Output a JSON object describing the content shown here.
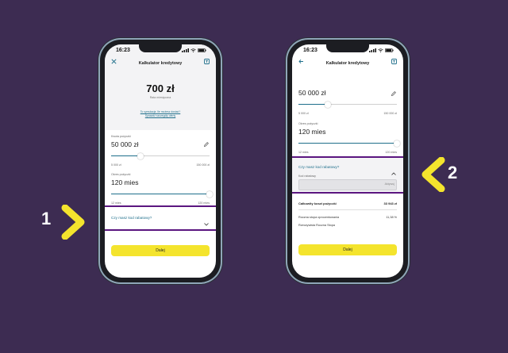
{
  "colors": {
    "background": "#3d2c52",
    "accent_yellow": "#f4e42d",
    "slider_blue": "#1f6f8b",
    "highlight_purple": "#5b1680"
  },
  "markers": {
    "left_number": "1",
    "right_number": "2"
  },
  "phone1": {
    "time": "16:23",
    "title": "Kalkulator kredytowy",
    "close_icon": "close-icon",
    "calc_icon": "calculator-icon",
    "payment": "700 zł",
    "payment_caption": "Rata miesięczna",
    "link_text": "To symulacja. Ile możesz dostać?",
    "link_text2": "Sprawdź szczegóły oferty",
    "amount_label": "Kwota pożyczki",
    "amount_value": "50 000 zł",
    "amount_min": "5 000 zł",
    "amount_max": "150 000 zł",
    "period_label": "Okres pożyczki",
    "period_value": "120 mies",
    "period_min": "12 mies",
    "period_max": "120 mies",
    "promo_question": "Czy masz kod rabatowy?",
    "next_button": "Dalej",
    "amount_fraction": 0.3,
    "period_fraction": 1.0
  },
  "phone2": {
    "time": "16:23",
    "title": "Kalkulator kredytowy",
    "amount_value": "50 000 zł",
    "amount_min": "5 000 zł",
    "amount_max": "150 000 zł",
    "period_label": "Okres pożyczki",
    "period_value": "120 mies",
    "period_min": "12 mies",
    "period_max": "120 mies",
    "promo_question": "Czy masz kod rabatowy?",
    "promo_field_label": "Kod rabatowy",
    "promo_apply": "Aktywuj",
    "total_cost_label": "Całkowity koszt pożyczki",
    "total_cost_value": "33 943 zł",
    "rate_label": "Roczna stopa oprocentowania",
    "rate_value": "11,38 %",
    "rrso_label": "Rzeczywista Roczna Stopa",
    "next_button": "Dalej",
    "amount_fraction": 0.3,
    "period_fraction": 1.0
  }
}
